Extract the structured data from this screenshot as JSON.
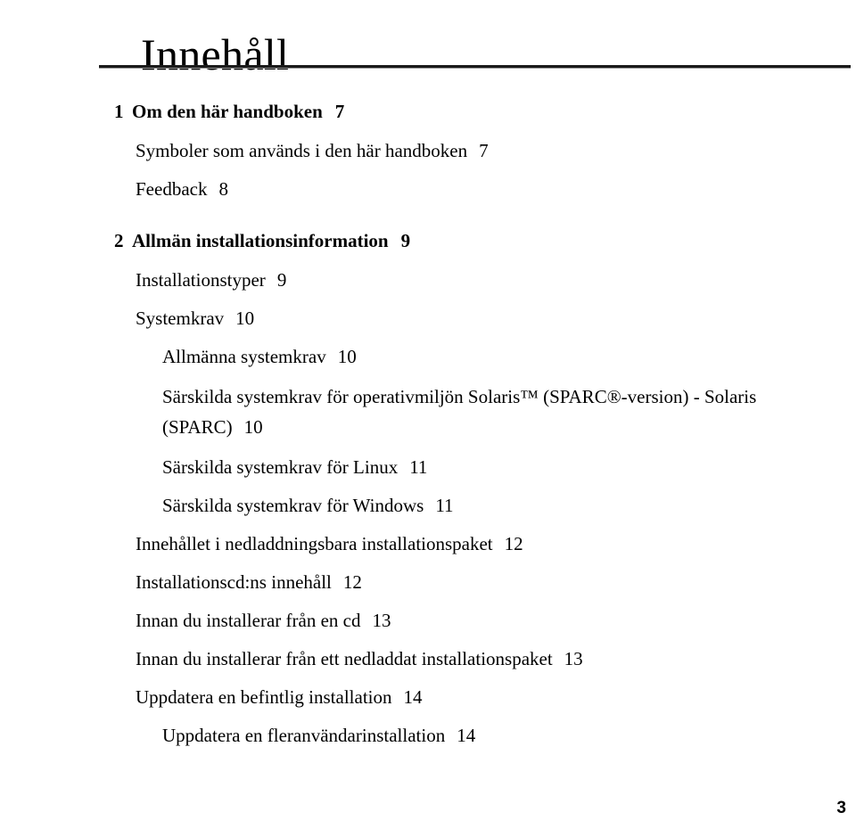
{
  "document": {
    "title": "Innehåll",
    "footer_page_number": "3",
    "rule_color": "#1a1a1a"
  },
  "toc": {
    "entries": [
      {
        "level": 1,
        "number": "1",
        "title": "Om den här handboken",
        "page": "7"
      },
      {
        "level": 2,
        "number": "",
        "title": "Symboler som används i den här handboken",
        "page": "7"
      },
      {
        "level": 2,
        "number": "",
        "title": "Feedback",
        "page": "8"
      },
      {
        "level": 1,
        "number": "2",
        "title": "Allmän installationsinformation",
        "page": "9"
      },
      {
        "level": 2,
        "number": "",
        "title": "Installationstyper",
        "page": "9"
      },
      {
        "level": 2,
        "number": "",
        "title": "Systemkrav",
        "page": "10"
      },
      {
        "level": 3,
        "number": "",
        "title": "Allmänna systemkrav",
        "page": "10"
      },
      {
        "level": 3,
        "number": "",
        "title": "Särskilda systemkrav för operativmiljön Solaris™ (SPARC®-version) - Solaris (SPARC)",
        "page": "10",
        "wraps": true
      },
      {
        "level": 3,
        "number": "",
        "title": "Särskilda systemkrav för Linux",
        "page": "11"
      },
      {
        "level": 3,
        "number": "",
        "title": "Särskilda systemkrav för Windows",
        "page": "11"
      },
      {
        "level": 2,
        "number": "",
        "title": "Innehållet i nedladdningsbara installationspaket",
        "page": "12"
      },
      {
        "level": 2,
        "number": "",
        "title": "Installationscd:ns innehåll",
        "page": "12"
      },
      {
        "level": 2,
        "number": "",
        "title": "Innan du installerar från en cd",
        "page": "13"
      },
      {
        "level": 2,
        "number": "",
        "title": "Innan du installerar från ett nedladdat installationspaket",
        "page": "13"
      },
      {
        "level": 2,
        "number": "",
        "title": "Uppdatera en befintlig installation",
        "page": "14"
      },
      {
        "level": 3,
        "number": "",
        "title": "Uppdatera en fleranvändarinstallation",
        "page": "14"
      }
    ]
  }
}
